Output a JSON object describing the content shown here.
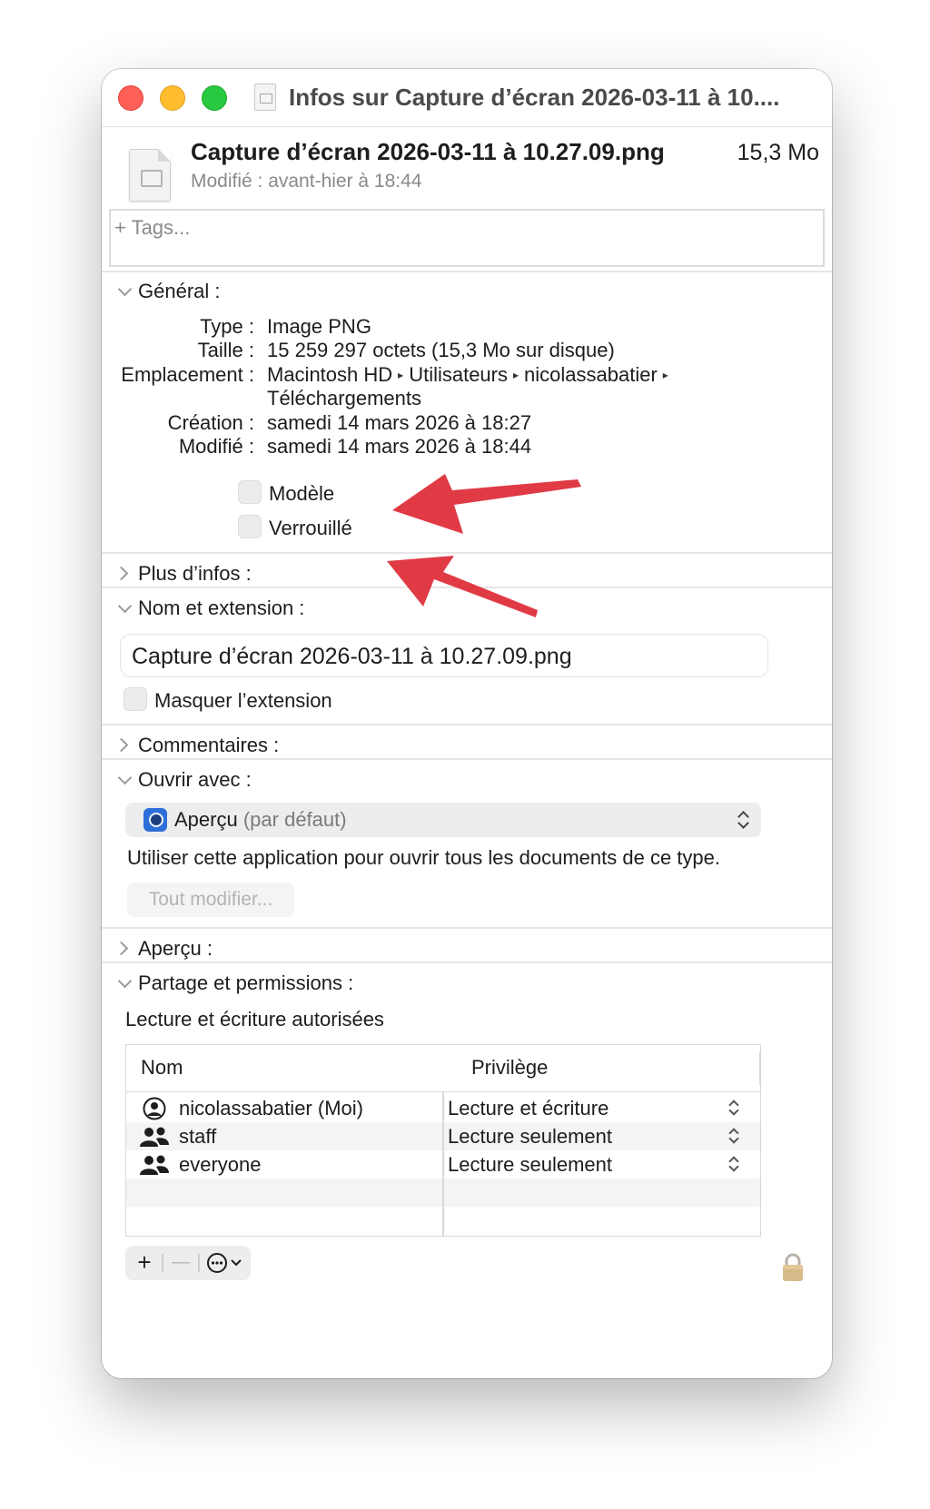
{
  "window": {
    "title": "Infos sur Capture d’écran 2026-03-11 à 10....",
    "colors": {
      "close": "#ff5f57",
      "minimize": "#febc2e",
      "maximize": "#28c840",
      "annotation_arrow": "#e03a45"
    }
  },
  "file": {
    "name": "Capture d’écran 2026-03-11 à 10.27.09.png",
    "size": "15,3 Mo",
    "modified": "Modifié : avant-hier à 18:44",
    "icon": "png-file-icon"
  },
  "tags": {
    "placeholder": "+ Tags..."
  },
  "general": {
    "title": "Général :",
    "expanded": true,
    "rows": [
      {
        "label": "Type :",
        "value": "Image PNG"
      },
      {
        "label": "Taille :",
        "value": "15 259 297 octets (15,3 Mo sur disque)"
      },
      {
        "label": "Emplacement :",
        "path": [
          "Macintosh HD",
          "Utilisateurs",
          "nicolassabatier"
        ],
        "path_separator": "▸",
        "path_continued": "Téléchargements"
      },
      {
        "label": "Création :",
        "value": "samedi 14 mars 2026 à 18:27"
      },
      {
        "label": "Modifié :",
        "value": "samedi 14 mars 2026 à 18:44"
      }
    ],
    "checkboxes": [
      {
        "label": "Modèle",
        "checked": false
      },
      {
        "label": "Verrouillé",
        "checked": false
      }
    ]
  },
  "more_info": {
    "title": "Plus d’infos :",
    "expanded": false
  },
  "name_extension": {
    "title": "Nom et extension :",
    "expanded": true,
    "value": "Capture d’écran 2026-03-11 à 10.27.09.png",
    "hide_extension": {
      "label": "Masquer l’extension",
      "checked": false
    }
  },
  "comments": {
    "title": "Commentaires :",
    "expanded": false
  },
  "open_with": {
    "title": "Ouvrir avec :",
    "expanded": true,
    "app": "Aperçu",
    "app_suffix": "(par défaut)",
    "app_icon": "preview-app-icon",
    "hint": "Utiliser cette application pour ouvrir tous les documents de ce type.",
    "change_all_button": "Tout modifier..."
  },
  "preview": {
    "title": "Aperçu :",
    "expanded": false
  },
  "sharing": {
    "title": "Partage et permissions :",
    "expanded": true,
    "summary": "Lecture et écriture autorisées",
    "columns": [
      "Nom",
      "Privilège"
    ],
    "rows": [
      {
        "name": "nicolassabatier (Moi)",
        "privilege": "Lecture et écriture",
        "icon": "user-icon"
      },
      {
        "name": "staff",
        "privilege": "Lecture seulement",
        "icon": "group-icon"
      },
      {
        "name": "everyone",
        "privilege": "Lecture seulement",
        "icon": "group-icon"
      }
    ],
    "toolbar": {
      "add": "+",
      "remove": "—"
    }
  }
}
